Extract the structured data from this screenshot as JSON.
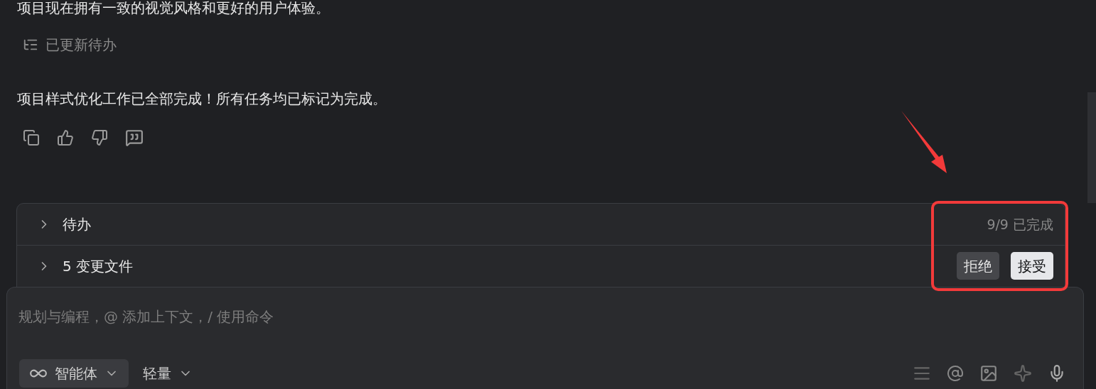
{
  "summary_text": "项目现在拥有一致的视觉风格和更好的用户体验。",
  "todo_update": {
    "label": "已更新待办"
  },
  "completion_text": "项目样式优化工作已全部完成！所有任务均已标记为完成。",
  "sections": [
    {
      "title": "待办",
      "expanded": false,
      "status": "9/9 已完成"
    },
    {
      "title": "5 变更文件",
      "expanded": false,
      "actions": [
        {
          "label": "拒绝",
          "kind": "secondary"
        },
        {
          "label": "接受",
          "kind": "primary"
        }
      ]
    }
  ],
  "composer": {
    "placeholder": "规划与编程，@ 添加上下文，/ 使用命令",
    "mode": {
      "label": "智能体"
    },
    "model": {
      "label": "轻量"
    }
  }
}
